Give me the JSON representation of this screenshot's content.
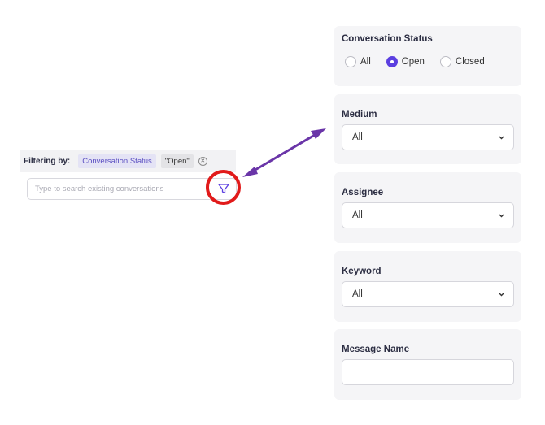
{
  "filter_bar": {
    "label": "Filtering by:",
    "chip_status": "Conversation Status",
    "chip_value": "\"Open\"",
    "remove_icon": "close-circle-icon"
  },
  "search": {
    "placeholder": "Type to search existing conversations",
    "filter_icon": "filter-funnel-icon"
  },
  "annotations": {
    "ring_color": "#e11a1a",
    "arrow_color": "#6a35a8"
  },
  "panels": {
    "status": {
      "title": "Conversation Status",
      "options": [
        "All",
        "Open",
        "Closed"
      ],
      "selected": "Open"
    },
    "medium": {
      "title": "Medium",
      "value": "All"
    },
    "assignee": {
      "title": "Assignee",
      "value": "All"
    },
    "keyword": {
      "title": "Keyword",
      "value": "All"
    },
    "message_name": {
      "title": "Message Name",
      "value": ""
    }
  },
  "colors": {
    "accent": "#5b3fe0",
    "chip_text": "#5b4fc2",
    "panel_bg": "#f5f5f7"
  }
}
